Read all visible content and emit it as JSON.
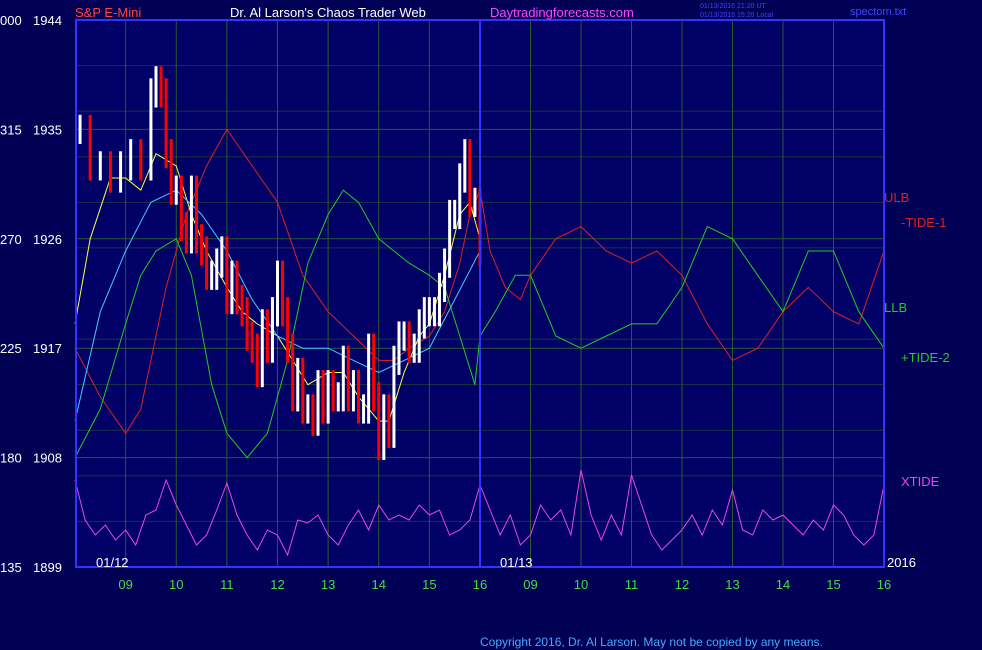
{
  "header": {
    "symbol": "S&P E-Mini",
    "title": "Dr. Al Larson's Chaos Trader Web",
    "site": "Daytradingforecasts.com",
    "stamp_ut": "01/13/2016 21:20 UT",
    "stamp_local": "01/13/2016 15:20 Local",
    "file": "spectom.txt"
  },
  "footer": {
    "copyright": "Copyright 2016, Dr. Al Larson. May not be copied by any means."
  },
  "colors": {
    "background": "#000055",
    "plot_background": "#000066",
    "grid": "#2a5a2a",
    "border": "#3333ff",
    "price_up": "#ffffff",
    "price_down": "#ff0000",
    "ulb": "#dd2222",
    "llb": "#22cc22",
    "tide_fast": "#ffff44",
    "tide_mid": "#44ccff",
    "xtide": "#ee44ee",
    "axis_text": "#ffffff",
    "time_text": "#44dd44",
    "symbol_text": "#ff4444",
    "title_text": "#ffffff",
    "site_text": "#ff44ff",
    "stamp_text": "#4444ff",
    "copyright_text": "#44aaff"
  },
  "chart_data": {
    "type": "line",
    "title": "S&P E-Mini",
    "ylim": [
      1899,
      1944
    ],
    "y_ticks_right": [
      "1944",
      "1935",
      "1926",
      "1917",
      "1908",
      "1899"
    ],
    "y_ticks_left": [
      "000",
      "315",
      "270",
      "225",
      "180",
      "135"
    ],
    "x_ticks": [
      "09",
      "10",
      "11",
      "12",
      "13",
      "14",
      "15",
      "16",
      "09",
      "10",
      "11",
      "12",
      "13",
      "14",
      "15",
      "16"
    ],
    "date_labels": [
      "01/12",
      "01/13"
    ],
    "year_label": "2016",
    "grid": true,
    "price": {
      "hours": [
        8.1,
        8.3,
        8.5,
        8.7,
        8.9,
        9.1,
        9.3,
        9.5,
        9.6,
        9.7,
        9.8,
        9.9,
        10.0,
        10.1,
        10.2,
        10.3,
        10.4,
        10.5,
        10.6,
        10.7,
        10.8,
        10.9,
        11.0,
        11.1,
        11.2,
        11.3,
        11.4,
        11.5,
        11.6,
        11.7,
        11.8,
        11.9,
        12.0,
        12.1,
        12.2,
        12.3,
        12.4,
        12.5,
        12.6,
        12.7,
        12.8,
        12.9,
        13.0,
        13.1,
        13.2,
        13.3,
        13.4,
        13.5,
        13.6,
        13.7,
        13.8,
        13.9,
        14.0,
        14.1,
        14.2,
        14.3,
        14.4,
        14.5,
        14.6,
        14.7,
        14.8,
        14.9,
        15.0,
        15.1,
        15.2,
        15.3,
        15.4,
        15.5,
        15.6,
        15.7,
        15.8,
        15.9,
        16.0
      ],
      "values": [
        1935,
        1932,
        1932,
        1931,
        1932,
        1933,
        1932,
        1938,
        1939,
        1938,
        1933,
        1930,
        1930,
        1927,
        1926,
        1930,
        1926,
        1925,
        1923,
        1923,
        1924,
        1925,
        1921,
        1923,
        1921,
        1920,
        1918,
        1917,
        1915,
        1919,
        1917,
        1920,
        1923,
        1920,
        1917,
        1913,
        1915,
        1912,
        1912,
        1911,
        1914,
        1912,
        1914,
        1913,
        1913,
        1916,
        1913,
        1914,
        1912,
        1912,
        1917,
        1913,
        1909,
        1912,
        1910,
        1916,
        1918,
        1918,
        1917,
        1917,
        1919,
        1920,
        1920,
        1920,
        1922,
        1924,
        1928,
        1928,
        1931,
        1933,
        1929,
        1929,
        1925
      ]
    },
    "series": [
      {
        "name": "ULB",
        "hours": [
          8.0,
          8.5,
          9.0,
          9.3,
          9.5,
          9.8,
          10.2,
          10.6,
          11.0,
          11.5,
          12.0,
          12.5,
          13.0,
          13.5,
          14.0,
          14.3,
          14.6,
          15.0,
          15.3,
          15.6,
          15.8,
          16.0,
          16.2,
          16.5,
          16.8,
          17.0,
          17.5,
          18.0,
          18.5,
          19.0,
          19.5,
          20.0,
          20.5,
          21.0,
          21.5,
          22.0,
          22.5,
          23.0,
          23.5,
          24.0
        ],
        "values": [
          1917,
          1913,
          1910,
          1912,
          1916,
          1922,
          1928,
          1932,
          1935,
          1932,
          1929,
          1923,
          1920,
          1918,
          1916,
          1916,
          1917,
          1918,
          1920,
          1924,
          1928,
          1930,
          1925,
          1922,
          1921,
          1923,
          1926,
          1927,
          1925,
          1924,
          1925,
          1923,
          1919,
          1916,
          1917,
          1920,
          1922,
          1920,
          1919,
          1925
        ]
      },
      {
        "name": "LLB",
        "hours": [
          8.0,
          8.5,
          9.0,
          9.3,
          9.6,
          10.0,
          10.3,
          10.7,
          11.0,
          11.4,
          11.8,
          12.2,
          12.6,
          13.0,
          13.3,
          13.6,
          14.0,
          14.3,
          14.6,
          15.0,
          15.3,
          15.6,
          15.9,
          16.0,
          16.3,
          16.7,
          17.0,
          17.5,
          18.0,
          18.5,
          19.0,
          19.5,
          20.0,
          20.5,
          21.0,
          21.5,
          22.0,
          22.5,
          23.0,
          23.5,
          24.0
        ],
        "values": [
          1908,
          1912,
          1919,
          1923,
          1925,
          1926,
          1923,
          1914,
          1910,
          1908,
          1910,
          1916,
          1924,
          1928,
          1930,
          1929,
          1926,
          1925,
          1924,
          1923,
          1922,
          1918,
          1914,
          1918,
          1920,
          1923,
          1923,
          1918,
          1917,
          1918,
          1919,
          1919,
          1922,
          1927,
          1926,
          1923,
          1920,
          1925,
          1925,
          1920,
          1917
        ]
      },
      {
        "name": "tide-fast",
        "hours": [
          8.0,
          8.3,
          8.7,
          9.0,
          9.3,
          9.6,
          10.0,
          10.3,
          10.6,
          11.0,
          11.3,
          11.6,
          12.0,
          12.3,
          12.6,
          13.0,
          13.3,
          13.6,
          14.0,
          14.2,
          14.5,
          14.8,
          15.0,
          15.3,
          15.6,
          15.8,
          16.0
        ],
        "values": [
          1919,
          1926,
          1931,
          1931,
          1930,
          1933,
          1932,
          1928,
          1925,
          1922,
          1920,
          1919,
          1918,
          1916,
          1914,
          1915,
          1915,
          1913,
          1911,
          1911,
          1915,
          1918,
          1919,
          1923,
          1928,
          1929,
          1926
        ]
      },
      {
        "name": "tide-mid",
        "hours": [
          8.0,
          8.5,
          9.0,
          9.5,
          10.0,
          10.5,
          11.0,
          11.5,
          12.0,
          12.5,
          13.0,
          13.5,
          14.0,
          14.5,
          15.0,
          15.5,
          16.0
        ],
        "values": [
          1911,
          1920,
          1925,
          1929,
          1930,
          1928,
          1925,
          1921,
          1918,
          1917,
          1917,
          1916,
          1915,
          1916,
          1917,
          1921,
          1925
        ]
      }
    ],
    "xtide": {
      "hours": [
        8.0,
        8.2,
        8.4,
        8.6,
        8.8,
        9.0,
        9.2,
        9.4,
        9.6,
        9.8,
        10.0,
        10.2,
        10.4,
        10.6,
        10.8,
        11.0,
        11.2,
        11.4,
        11.6,
        11.8,
        12.0,
        12.2,
        12.4,
        12.6,
        12.8,
        13.0,
        13.2,
        13.4,
        13.6,
        13.8,
        14.0,
        14.2,
        14.4,
        14.6,
        14.8,
        15.0,
        15.2,
        15.4,
        15.6,
        15.8,
        16.0,
        16.2,
        16.4,
        16.6,
        16.8,
        17.0,
        17.2,
        17.4,
        17.6,
        17.8,
        18.0,
        18.2,
        18.4,
        18.6,
        18.8,
        19.0,
        19.2,
        19.4,
        19.6,
        19.8,
        20.0,
        20.2,
        20.4,
        20.6,
        20.8,
        21.0,
        21.2,
        21.4,
        21.6,
        21.8,
        22.0,
        22.2,
        22.4,
        22.6,
        22.8,
        23.0,
        23.2,
        23.4,
        23.6,
        23.8,
        24.0
      ],
      "values": [
        0.85,
        0.45,
        0.3,
        0.4,
        0.25,
        0.35,
        0.2,
        0.5,
        0.55,
        0.85,
        0.6,
        0.4,
        0.2,
        0.3,
        0.55,
        0.82,
        0.5,
        0.3,
        0.15,
        0.35,
        0.3,
        0.1,
        0.45,
        0.42,
        0.5,
        0.3,
        0.2,
        0.4,
        0.55,
        0.35,
        0.6,
        0.45,
        0.5,
        0.45,
        0.6,
        0.5,
        0.55,
        0.3,
        0.35,
        0.45,
        0.8,
        0.55,
        0.3,
        0.5,
        0.2,
        0.3,
        0.6,
        0.45,
        0.55,
        0.3,
        0.95,
        0.5,
        0.25,
        0.5,
        0.3,
        0.9,
        0.6,
        0.3,
        0.15,
        0.25,
        0.35,
        0.5,
        0.3,
        0.55,
        0.4,
        0.75,
        0.35,
        0.3,
        0.55,
        0.45,
        0.5,
        0.4,
        0.3,
        0.45,
        0.35,
        0.6,
        0.5,
        0.3,
        0.2,
        0.3,
        0.8
      ]
    },
    "right_labels": [
      {
        "name": "ULB",
        "text": "ULB",
        "color": "#dd2222"
      },
      {
        "name": "-TIDE-1",
        "text": "-TIDE-1",
        "color": "#dd2222"
      },
      {
        "name": "LLB",
        "text": "LLB",
        "color": "#22cc22"
      },
      {
        "name": "+TIDE-2",
        "text": "+TIDE-2",
        "color": "#22cc22"
      },
      {
        "name": "XTIDE",
        "text": "XTIDE",
        "color": "#ee44ee"
      }
    ]
  }
}
